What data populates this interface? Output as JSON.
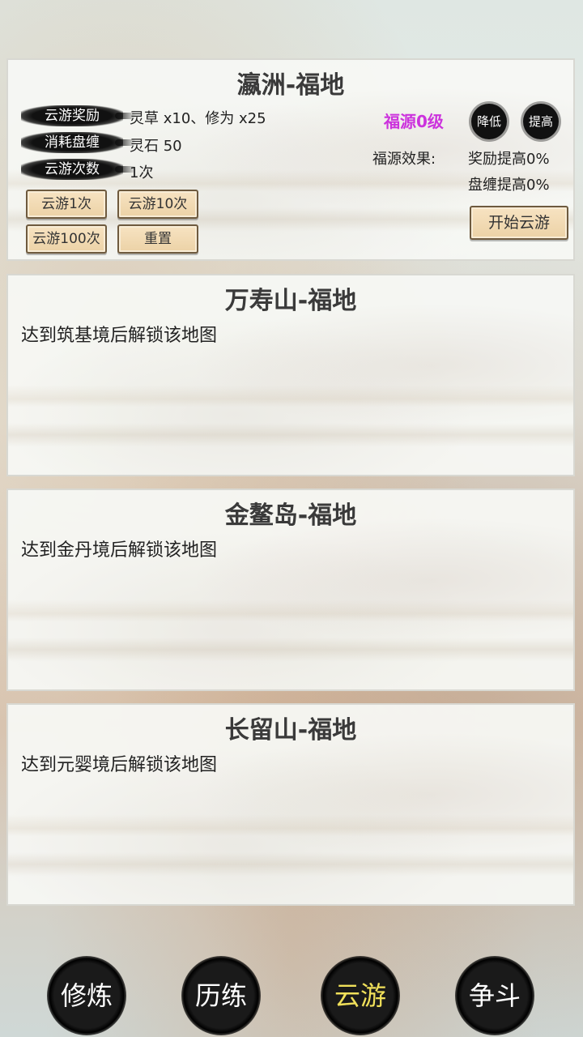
{
  "maps": [
    {
      "title": "瀛洲-福地",
      "rows": [
        {
          "label": "云游奖励",
          "value": "灵草 x10、修为 x25"
        },
        {
          "label": "消耗盘缠",
          "value": "灵石 50"
        },
        {
          "label": "云游次数",
          "value": "1次"
        }
      ],
      "buttons": [
        "云游1次",
        "云游10次",
        "云游100次",
        "重置"
      ],
      "level": "福源0级",
      "decrease": "降低",
      "increase": "提高",
      "effect_label": "福源效果:",
      "effect_reward": "奖励提高0%",
      "effect_cost": "盘缠提高0%",
      "start": "开始云游"
    },
    {
      "title": "万寿山-福地",
      "locked_text": "达到筑基境后解锁该地图"
    },
    {
      "title": "金鳌岛-福地",
      "locked_text": "达到金丹境后解锁该地图"
    },
    {
      "title": "长留山-福地",
      "locked_text": "达到元婴境后解锁该地图"
    }
  ],
  "nav": [
    "修炼",
    "历练",
    "云游",
    "争斗"
  ],
  "nav_active": "云游",
  "colors": {
    "level": "#cc33dd",
    "nav_active": "#f0e05a"
  }
}
